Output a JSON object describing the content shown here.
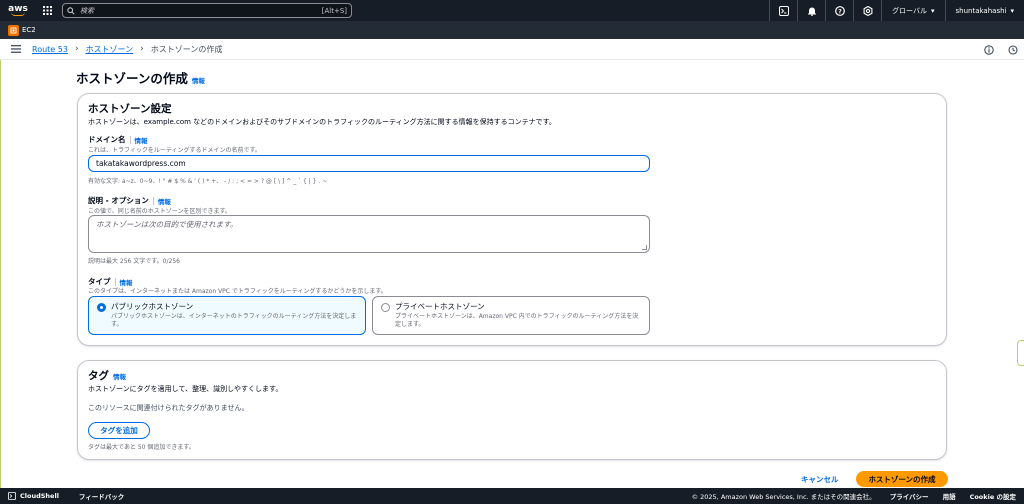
{
  "topnav": {
    "logo": "aws",
    "search_placeholder": "検索",
    "search_shortcut": "[Alt+S]",
    "region": "グローバル",
    "user": "shuntakahashi",
    "icons": [
      "cloudshell-icon",
      "bell-icon",
      "help-icon",
      "gear-icon"
    ]
  },
  "favorites": {
    "ec2": "EC2"
  },
  "breadcrumb": {
    "items": [
      "Route 53",
      "ホストゾーン",
      "ホストゾーンの作成"
    ]
  },
  "page": {
    "title": "ホストゾーンの作成",
    "info": "情報"
  },
  "hosted_zone": {
    "heading": "ホストゾーン設定",
    "description": "ホストゾーンは、example.com などのドメインおよびそのサブドメインのトラフィックのルーティング方法に関する情報を保持するコンテナです。",
    "domain_label": "ドメイン名",
    "domain_info": "情報",
    "domain_desc": "これは、トラフィックをルーティングするドメインの名前です。",
    "domain_value": "takatakawordpress.com",
    "domain_hint": "有効な文字: a~z、0~9、! \" # $ % & ' ( ) * +、 - / : ; < = > ? @ [ \\ ] ^ _ ` { | } . ~",
    "desc_label": "説明 - オプション",
    "desc_info": "情報",
    "desc_desc": "この値で、同じ名前のホストゾーンを区別できます。",
    "desc_placeholder": "ホストゾーンは次の目的で使用されます。",
    "desc_hint": "説明は最大 256 文字です。0/256",
    "type_label": "タイプ",
    "type_info": "情報",
    "type_desc": "このタイプは、インターネットまたは Amazon VPC でトラフィックをルーティングするかどうかを示します。",
    "public_title": "パブリックホストゾーン",
    "public_desc": "パブリックホストゾーンは、インターネットのトラフィックのルーティング方法を決定します。",
    "private_title": "プライベートホストゾーン",
    "private_desc": "プライベートホストゾーンは、Amazon VPC 内でのトラフィックのルーティング方法を決定します。",
    "selected": "public"
  },
  "tags": {
    "heading": "タグ",
    "info": "情報",
    "description": "ホストゾーンにタグを適用して、整理、識別しやすくします。",
    "empty": "このリソースに関連付けられたタグがありません。",
    "add_button": "タグを追加",
    "hint": "タグは最大であと 50 個追加できます。"
  },
  "actions": {
    "cancel": "キャンセル",
    "create": "ホストゾーンの作成"
  },
  "footer": {
    "cloudshell": "CloudShell",
    "feedback": "フィードバック",
    "copyright": "© 2025, Amazon Web Services, Inc. またはその関連会社。",
    "privacy": "プライバシー",
    "terms": "用語",
    "cookie": "Cookie の設定"
  },
  "colors": {
    "accent": "#006ce0",
    "primary_button": "#ff9900",
    "nav_bg": "#161d26"
  }
}
